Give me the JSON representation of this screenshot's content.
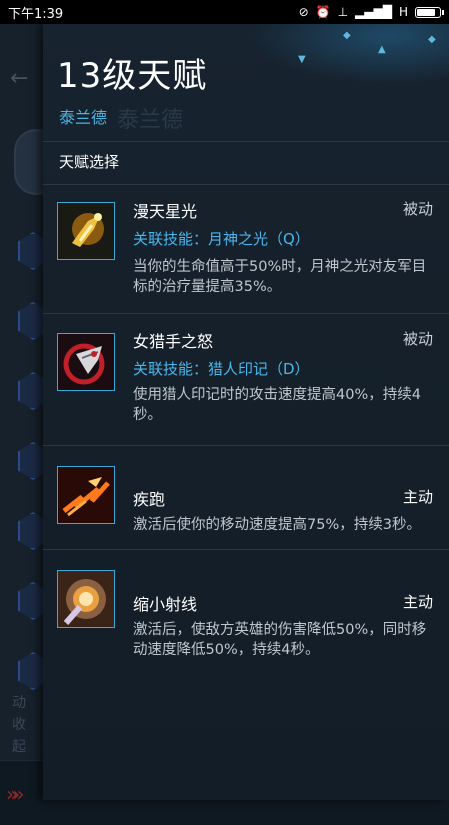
{
  "status_bar": {
    "time": "下午1:39",
    "network_label": "H",
    "icons": [
      "alarm-off-icon",
      "alarm-icon",
      "signal-icon",
      "signal-bars-icon",
      "battery-icon"
    ]
  },
  "underlying": {
    "side_text": [
      "动",
      "收",
      "起"
    ],
    "back_icon": "back-arrow-icon"
  },
  "drawer": {
    "title": "13级天赋",
    "hero_name": "泰兰德",
    "hero_name_ghost": "泰兰德",
    "section_label": "天赋选择",
    "talents": [
      {
        "name": "漫天星光",
        "type": "被动",
        "link": "关联技能：月神之光（Q）",
        "desc": "当你的生命值高于50%时，月神之光对友军目标的治疗量提高35%。",
        "icon": "starlight-icon"
      },
      {
        "name": "女猎手之怒",
        "type": "被动",
        "link": "关联技能：猎人印记（D）",
        "desc": "使用猎人印记时的攻击速度提高40%，持续4秒。",
        "icon": "huntress-fury-icon"
      },
      {
        "name": "疾跑",
        "type": "主动",
        "link": "",
        "desc": "激活后使你的移动速度提高75%，持续3秒。",
        "icon": "sprint-icon"
      },
      {
        "name": "缩小射线",
        "type": "主动",
        "link": "",
        "desc": "激活后，使敌方英雄的伤害降低50%，同时移动速度降低50%，持续4秒。",
        "icon": "shrink-ray-icon"
      }
    ]
  },
  "colors": {
    "accent": "#49b6ec",
    "background": "#15202b",
    "title": "#ffffff"
  }
}
